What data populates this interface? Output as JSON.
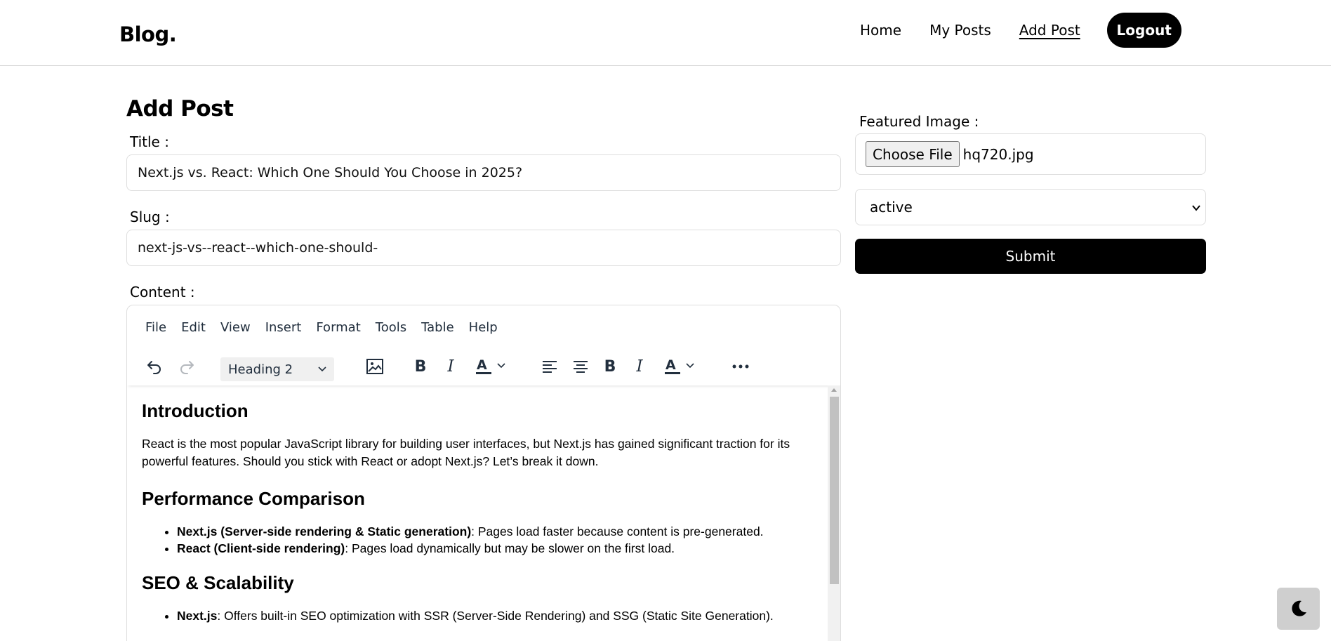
{
  "header": {
    "logo": "Blog.",
    "nav": [
      {
        "label": "Home"
      },
      {
        "label": "My Posts"
      },
      {
        "label": "Add Post"
      }
    ],
    "logout_label": "Logout"
  },
  "form": {
    "page_title": "Add Post",
    "title_label": "Title :",
    "title_value": "Next.js vs. React: Which One Should You Choose in 2025?",
    "slug_label": "Slug :",
    "slug_value": "next-js-vs--react--which-one-should-",
    "content_label": "Content :"
  },
  "editor": {
    "menu": [
      "File",
      "Edit",
      "View",
      "Insert",
      "Format",
      "Tools",
      "Table",
      "Help"
    ],
    "block_format": "Heading 2",
    "toolbar_icons": [
      "undo-icon",
      "redo-icon",
      "image-icon",
      "bold-icon",
      "italic-icon",
      "text-color-icon",
      "align-left-icon",
      "align-center-icon",
      "bold-icon",
      "italic-icon",
      "text-color-icon",
      "more-icon"
    ],
    "content": {
      "h1": "Introduction",
      "p1": "React is the most popular JavaScript library for building user interfaces, but Next.js has gained significant traction for its powerful features. Should you stick with React or adopt Next.js? Let’s break it down.",
      "h2": "Performance Comparison",
      "list1": [
        {
          "strong": "Next.js (Server-side rendering & Static generation)",
          "text": ": Pages load faster because content is pre-generated."
        },
        {
          "strong": "React (Client-side rendering)",
          "text": ": Pages load dynamically but may be slower on the first load."
        }
      ],
      "h3": "SEO & Scalability",
      "list2": [
        {
          "strong": "Next.js",
          "text": ": Offers built-in SEO optimization with SSR (Server-Side Rendering) and SSG (Static Site Generation)."
        }
      ]
    }
  },
  "sidebar": {
    "featured_label": "Featured Image :",
    "choose_file_label": "Choose File",
    "file_name": "hq720.jpg",
    "status_value": "active",
    "submit_label": "Submit"
  },
  "colors": {
    "primary": "#000000",
    "border": "#dedede",
    "editor_text": "#222f3e"
  }
}
